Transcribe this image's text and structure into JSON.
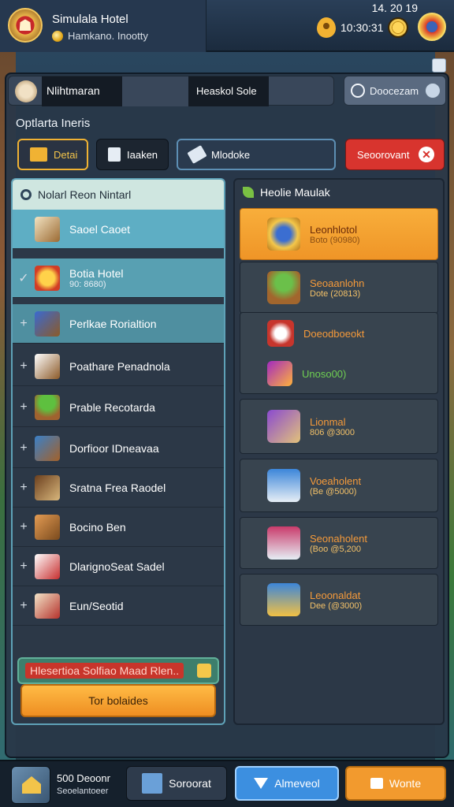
{
  "header": {
    "hotel_name": "Simulala Hotel",
    "hotel_subtitle": "Hamkano. Inootty",
    "time": "14. 20 19",
    "currency": "10:30:31"
  },
  "search": {
    "query": "Nlihtmaran",
    "result": "Heaskol Sole"
  },
  "top_chip": {
    "label": "Doocezam"
  },
  "section_title": "Optlarta Ineris",
  "filters": [
    {
      "label": "Detai"
    },
    {
      "label": "Iaaken"
    },
    {
      "label": "Mlodoke"
    },
    {
      "label": "Seoorovant"
    }
  ],
  "left_panel": {
    "header": "Nolarl Reon Nintarl",
    "items": [
      {
        "mark": "",
        "label": "Saoel Caoet",
        "sub": ""
      },
      {
        "mark": "✓",
        "label": "Botia Hotel",
        "sub": "90: 8680)"
      },
      {
        "mark": "+",
        "label": "Perlkae Rorialtion",
        "sub": ""
      },
      {
        "mark": "+",
        "label": "Poathare Penadnola",
        "sub": ""
      },
      {
        "mark": "+",
        "label": "Prable Recotarda",
        "sub": ""
      },
      {
        "mark": "+",
        "label": "Dorfioor IDneavaa",
        "sub": ""
      },
      {
        "mark": "+",
        "label": "Sratna Frea Raodel",
        "sub": ""
      },
      {
        "mark": "+",
        "label": "Bocino Ben",
        "sub": ""
      },
      {
        "mark": "+",
        "label": "DlarignoSeat Sadel",
        "sub": ""
      },
      {
        "mark": "+",
        "label": "Eun/Seotid",
        "sub": ""
      }
    ],
    "promo": "Hlesertioa Solfiao Maad Rlen..",
    "button": "Tor bolaides"
  },
  "right_panel": {
    "header": "Heolie Maulak",
    "cards": [
      {
        "name": "Leonhlotol",
        "price": "Boto (90980)"
      },
      {
        "name": "Seoaanlohn",
        "price": "Dote (20813)"
      },
      {
        "name": "Doeodboeokt",
        "price": ""
      },
      {
        "name": "Unoso00)",
        "price": ""
      },
      {
        "name": "Lionmal",
        "price": "806 @3000"
      },
      {
        "name": "Voeaholent",
        "price": "(Be @5000)"
      },
      {
        "name": "Seonaholent",
        "price": "(Boo @5,200"
      },
      {
        "name": "Leoonaldat",
        "price": "Dee (@3000)"
      }
    ]
  },
  "bottom": {
    "home_line1": "500 Deoonr",
    "home_line2": "Seoelantoeer",
    "search_label": "Soroorat",
    "approve_label": "Almeveol",
    "update_label": "Wonte"
  },
  "colors": {
    "accent_orange": "#f29a2e",
    "accent_blue": "#3c8fe0",
    "danger_red": "#d8342e",
    "highlight_teal": "#5eaec4"
  }
}
